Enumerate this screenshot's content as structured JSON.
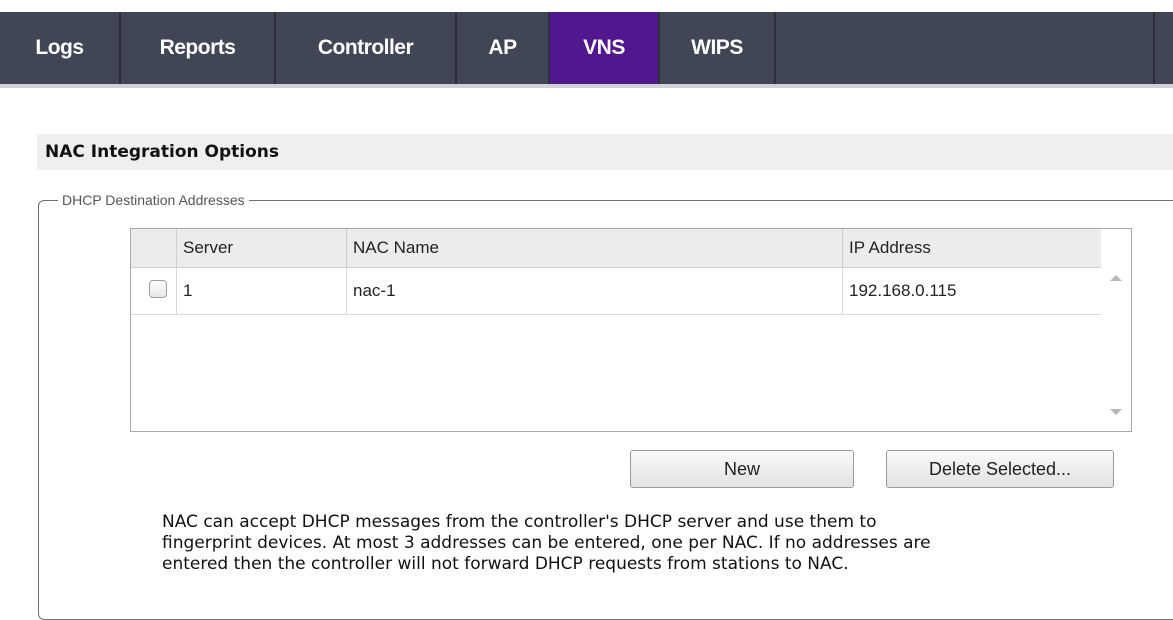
{
  "nav": {
    "tabs": [
      "Logs",
      "Reports",
      "Controller",
      "AP",
      "VNS",
      "WIPS"
    ],
    "active": "VNS"
  },
  "section": {
    "title": "NAC Integration Options"
  },
  "dhcp": {
    "legend": "DHCP Destination Addresses",
    "columns": [
      "Server",
      "NAC Name",
      "IP Address"
    ],
    "rows": [
      {
        "server": "1",
        "nac_name": "nac-1",
        "ip_address": "192.168.0.115",
        "checked": false
      }
    ]
  },
  "buttons": {
    "new_label": "New",
    "delete_label": "Delete Selected..."
  },
  "help_lines": [
    "NAC can accept DHCP messages from the controller's DHCP server and use them to",
    "fingerprint devices. At most 3 addresses can be entered, one per NAC. If no addresses are",
    "entered then the controller will not forward DHCP requests from stations to NAC."
  ],
  "colors": {
    "nav_bg": "#404654",
    "active_tab": "#52168e",
    "header_bg": "#efefef"
  },
  "icons": [
    "scroll-up-arrow-icon",
    "scroll-down-arrow-icon",
    "checkbox-icon"
  ]
}
